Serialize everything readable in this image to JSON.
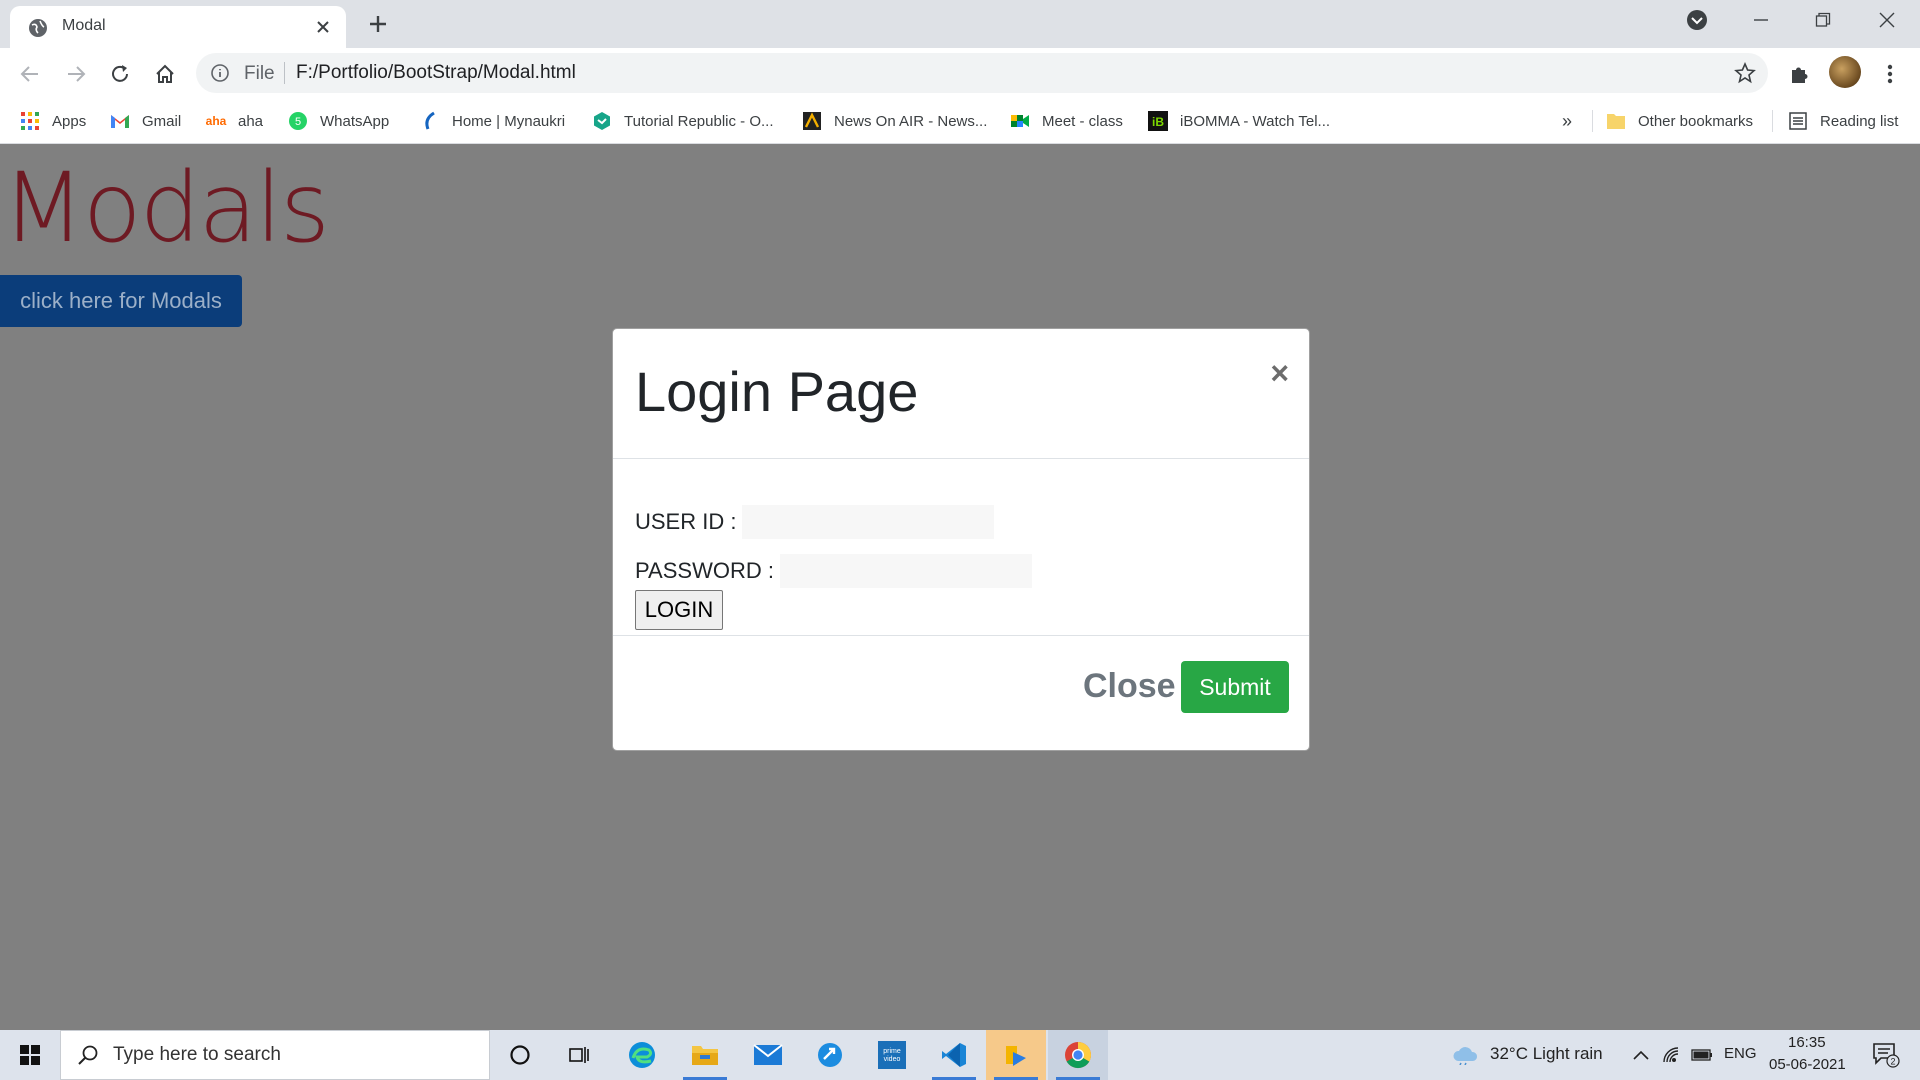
{
  "browser": {
    "tab_title": "Modal",
    "omnibox_scheme": "File",
    "url": "F:/Portfolio/BootStrap/Modal.html"
  },
  "bookmarks": {
    "items": [
      {
        "label": "Apps",
        "icon": "apps-grid-icon"
      },
      {
        "label": "Gmail",
        "icon": "gmail-icon"
      },
      {
        "label": "aha",
        "icon": "aha-icon"
      },
      {
        "label": "WhatsApp",
        "icon": "whatsapp-icon"
      },
      {
        "label": "Home | Mynaukri",
        "icon": "mynaukri-icon"
      },
      {
        "label": "Tutorial Republic - O...",
        "icon": "tutorial-republic-icon"
      },
      {
        "label": "News On AIR - News...",
        "icon": "news-on-air-icon"
      },
      {
        "label": "Meet - class",
        "icon": "google-meet-icon"
      },
      {
        "label": "iBOMMA - Watch Tel...",
        "icon": "ibomma-icon"
      }
    ],
    "overflow": "»",
    "other_bookmarks": "Other bookmarks",
    "reading_list": "Reading list"
  },
  "page": {
    "heading": "Modals",
    "open_modal_button": "click here for Modals"
  },
  "modal": {
    "title": "Login Page",
    "close_x": "×",
    "user_id_label": "USER ID :",
    "password_label": "PASSWORD :",
    "login_button": "LOGIN",
    "close_button": "Close",
    "submit_button": "Submit"
  },
  "taskbar": {
    "search_placeholder": "Type here to search",
    "weather": "32°C  Light rain",
    "language": "ENG",
    "time": "16:35",
    "date": "05-06-2021",
    "notification_count": "2"
  },
  "colors": {
    "page_background": "#808080",
    "heading": "#6e1a23",
    "primary_button": "#0b3d7a",
    "submit": "#28a745"
  }
}
